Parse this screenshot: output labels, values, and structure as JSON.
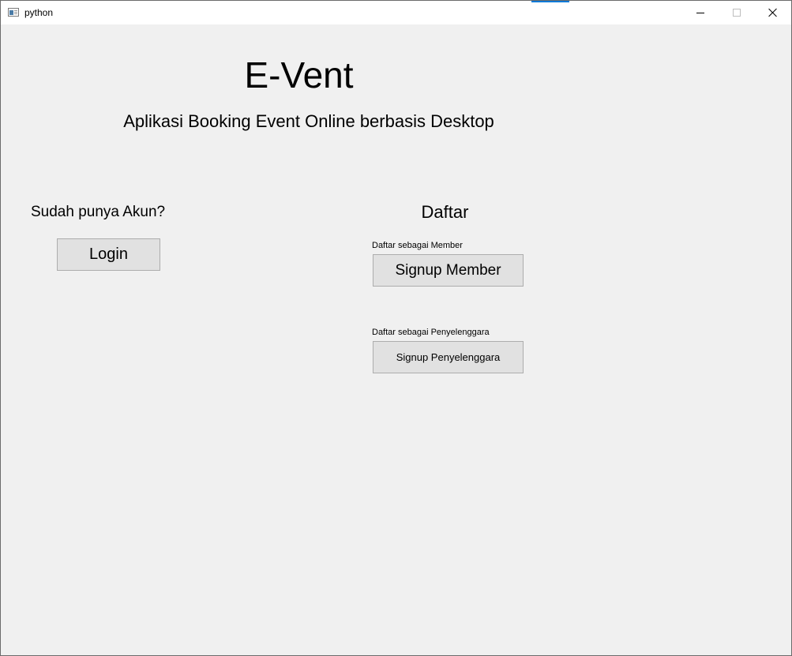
{
  "window": {
    "title": "python",
    "controls": {
      "minimize_icon": "minimize-icon",
      "maximize_icon": "maximize-icon",
      "close_icon": "close-icon"
    }
  },
  "main": {
    "app_title": "E-Vent",
    "app_subtitle": "Aplikasi Booking Event Online berbasis Desktop",
    "login_section": {
      "prompt": "Sudah punya Akun?",
      "login_button": "Login"
    },
    "register_section": {
      "heading": "Daftar",
      "member_label": "Daftar sebagai Member",
      "member_button": "Signup Member",
      "organizer_label": "Daftar sebagai Penyelenggara",
      "organizer_button": "Signup Penyelenggara"
    }
  },
  "colors": {
    "window_background": "#f0f0f0",
    "titlebar_background": "#ffffff",
    "button_background": "#e1e1e1",
    "button_border": "#adadad",
    "accent": "#0078d7"
  }
}
